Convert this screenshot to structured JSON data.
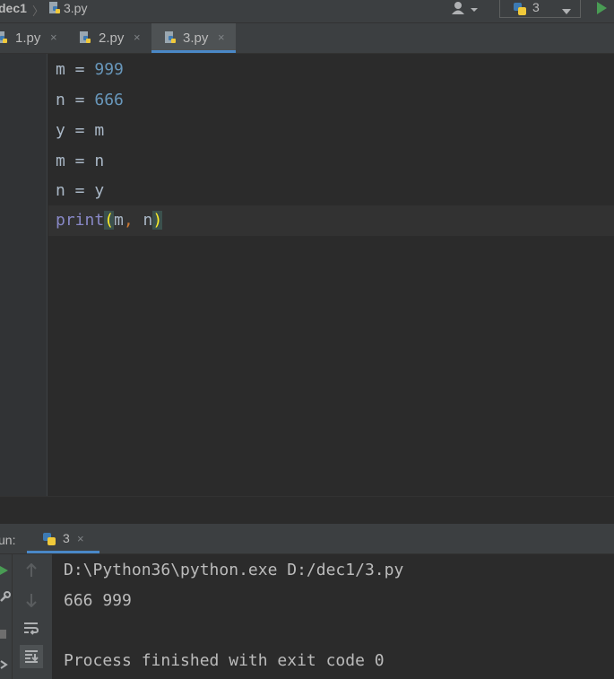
{
  "navbar": {
    "project": "dec1",
    "separator": "〉",
    "file": "3.py",
    "run_config": "3"
  },
  "tabs": [
    {
      "label": "1.py",
      "close": "×",
      "active": false
    },
    {
      "label": "2.py",
      "close": "×",
      "active": false
    },
    {
      "label": "3.py",
      "close": "×",
      "active": true
    }
  ],
  "editor": {
    "lines": [
      {
        "var": "m",
        "op": " = ",
        "value": "999"
      },
      {
        "var": "n",
        "op": " = ",
        "value": "666"
      },
      {
        "var": "y",
        "op": " = ",
        "value": "m"
      },
      {
        "var": "m",
        "op": " = ",
        "value": "n"
      },
      {
        "var": "n",
        "op": " = ",
        "value": "y"
      }
    ],
    "print_line": {
      "func": "print",
      "open": "(",
      "arg1": "m",
      "comma": ",",
      "arg2": " n",
      "close": ")"
    }
  },
  "run": {
    "title": "un:",
    "tab_label": "3",
    "tab_close": "×",
    "console_lines": [
      "D:\\Python36\\python.exe D:/dec1/3.py",
      "666 999",
      "",
      "Process finished with exit code 0"
    ]
  },
  "colors": {
    "background": "#2b2b2b",
    "panel": "#3c3f41",
    "accent": "#4a88c7",
    "number": "#6897bb",
    "builtin": "#8888c6",
    "keyword": "#cc7832",
    "run_green": "#499c54"
  },
  "icons": [
    "python-file-icon",
    "user-icon",
    "run-icon",
    "rerun-icon",
    "wrench-icon",
    "stop-icon",
    "up-arrow-icon",
    "down-arrow-icon",
    "soft-wrap-icon",
    "scroll-to-end-icon"
  ]
}
